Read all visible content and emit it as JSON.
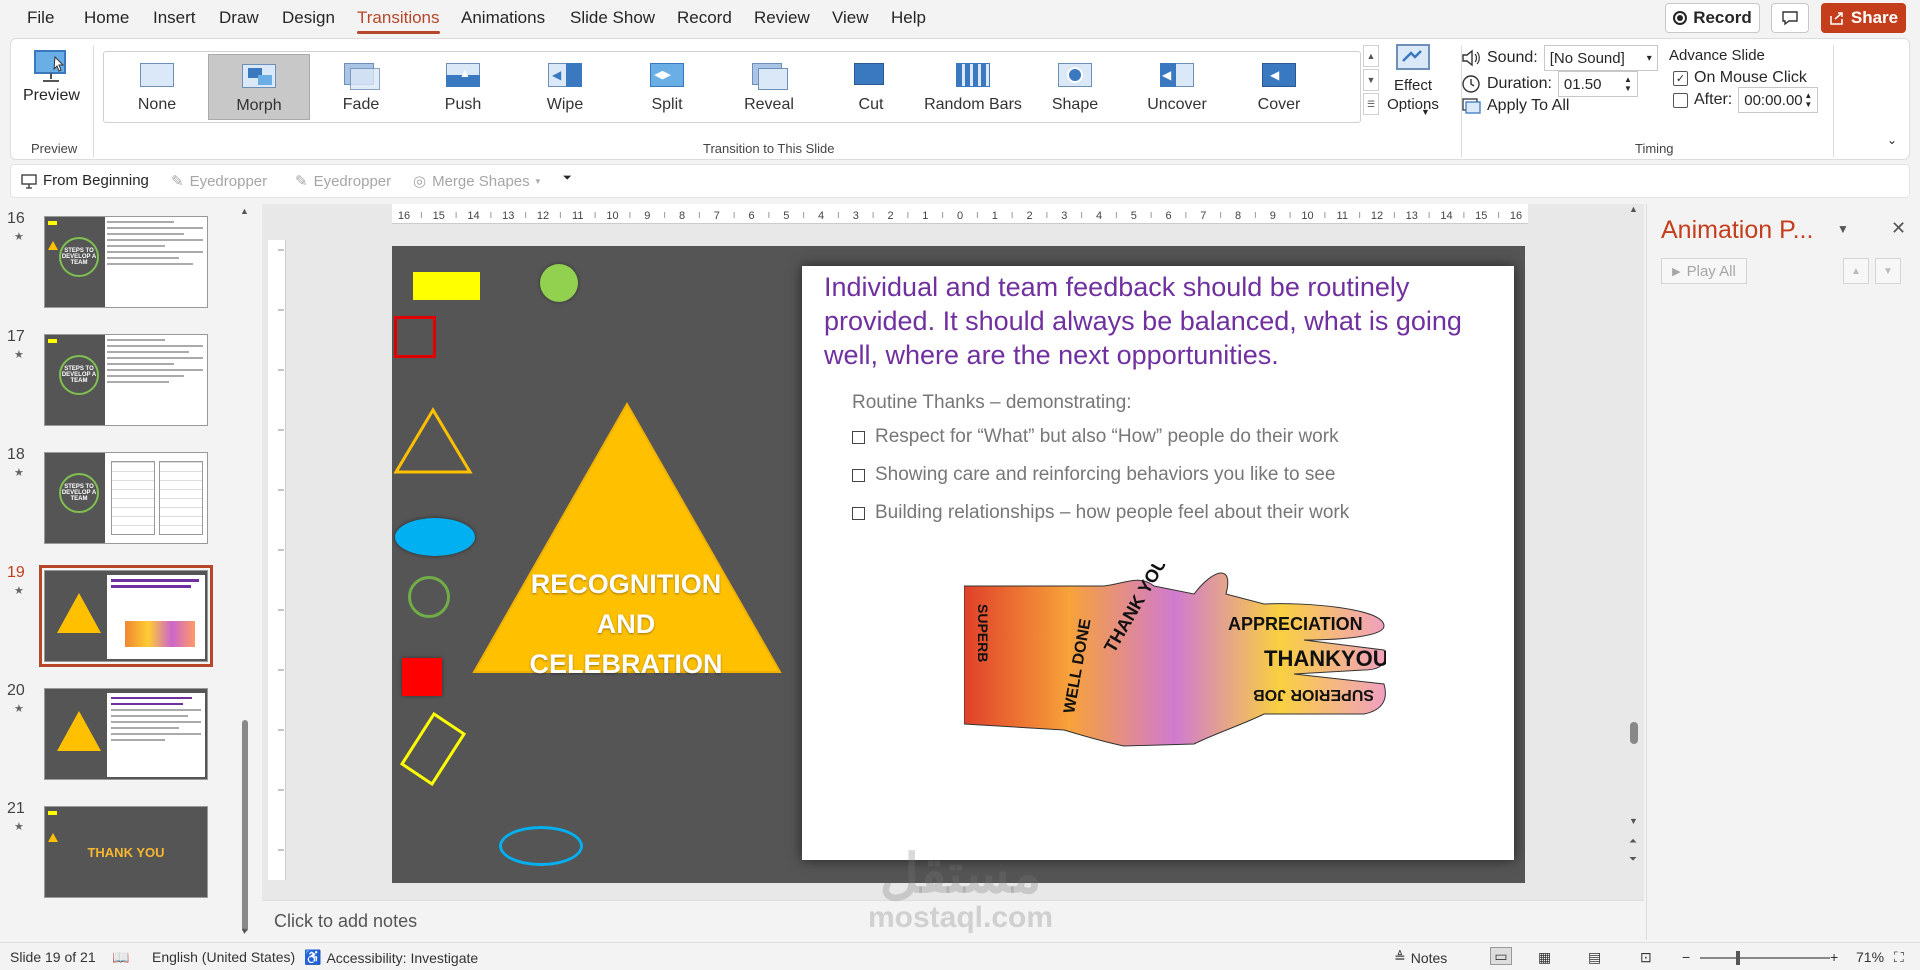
{
  "menu": {
    "items": [
      "File",
      "Home",
      "Insert",
      "Draw",
      "Design",
      "Transitions",
      "Animations",
      "Slide Show",
      "Record",
      "Review",
      "View",
      "Help"
    ],
    "active": "Transitions",
    "record_label": "Record",
    "share_label": "Share"
  },
  "ribbon": {
    "preview_label": "Preview",
    "preview_group": "Preview",
    "transitions": [
      "None",
      "Morph",
      "Fade",
      "Push",
      "Wipe",
      "Split",
      "Reveal",
      "Cut",
      "Random Bars",
      "Shape",
      "Uncover",
      "Cover"
    ],
    "selected_transition": "Morph",
    "effect_options_label": "Effect Options",
    "transition_group": "Transition to This Slide",
    "sound_label": "Sound:",
    "sound_value": "[No Sound]",
    "duration_label": "Duration:",
    "duration_value": "01.50",
    "apply_all_label": "Apply To All",
    "advance_label": "Advance Slide",
    "on_mouse_click_label": "On Mouse Click",
    "on_mouse_click_checked": true,
    "after_label": "After:",
    "after_value": "00:00.00",
    "after_checked": false,
    "timing_group": "Timing"
  },
  "quick_toolbar": {
    "from_beginning": "From Beginning",
    "eyedropper1": "Eyedropper",
    "eyedropper2": "Eyedropper",
    "merge_shapes": "Merge Shapes"
  },
  "thumbnails": [
    {
      "number": "16",
      "type": "steps"
    },
    {
      "number": "17",
      "type": "steps"
    },
    {
      "number": "18",
      "type": "steps-charts"
    },
    {
      "number": "19",
      "type": "recognition",
      "active": true
    },
    {
      "number": "20",
      "type": "recognition-text"
    },
    {
      "number": "21",
      "type": "thank-you",
      "thank_text": "THANK YOU"
    }
  ],
  "thumb_steps_text": "STEPS TO DEVELOP A TEAM",
  "slide": {
    "headline": "Individual and team feedback should be routinely provided. It should always be balanced, what is going well, where are the next opportunities.",
    "subheading": "Routine Thanks – demonstrating:",
    "bullets": [
      "Respect for “What” but also “How” people do their work",
      "Showing care and reinforcing behaviors you like to see",
      "Building relationships – how people feel about their work"
    ],
    "triangle_text": [
      "RECOGNITION",
      "AND",
      "CELEBRATION"
    ],
    "hand_words": [
      "APPRECIATION",
      "THANKYOU",
      "SUPERIOR JOB",
      "THANK YOU",
      "WELL DONE",
      "SUPERB"
    ]
  },
  "ruler_labels": [
    "16",
    "15",
    "14",
    "13",
    "12",
    "11",
    "10",
    "9",
    "8",
    "7",
    "6",
    "5",
    "4",
    "3",
    "2",
    "1",
    "0",
    "1",
    "2",
    "3",
    "4",
    "5",
    "6",
    "7",
    "8",
    "9",
    "10",
    "11",
    "12",
    "13",
    "14",
    "15",
    "16"
  ],
  "notes_placeholder": "Click to add notes",
  "animation_pane": {
    "title": "Animation P...",
    "play_all": "Play All"
  },
  "status": {
    "slide_count": "Slide 19 of 21",
    "language": "English (United States)",
    "accessibility": "Accessibility: Investigate",
    "notes_label": "Notes",
    "zoom": "71%"
  },
  "watermark": {
    "arabic": "مستقل",
    "latin": "mostaql.com"
  },
  "colors": {
    "accent": "#b7472a",
    "share": "#c43e1c",
    "headline": "#7030a0",
    "triangle": "#ffc000",
    "slide_bg": "#555555"
  }
}
